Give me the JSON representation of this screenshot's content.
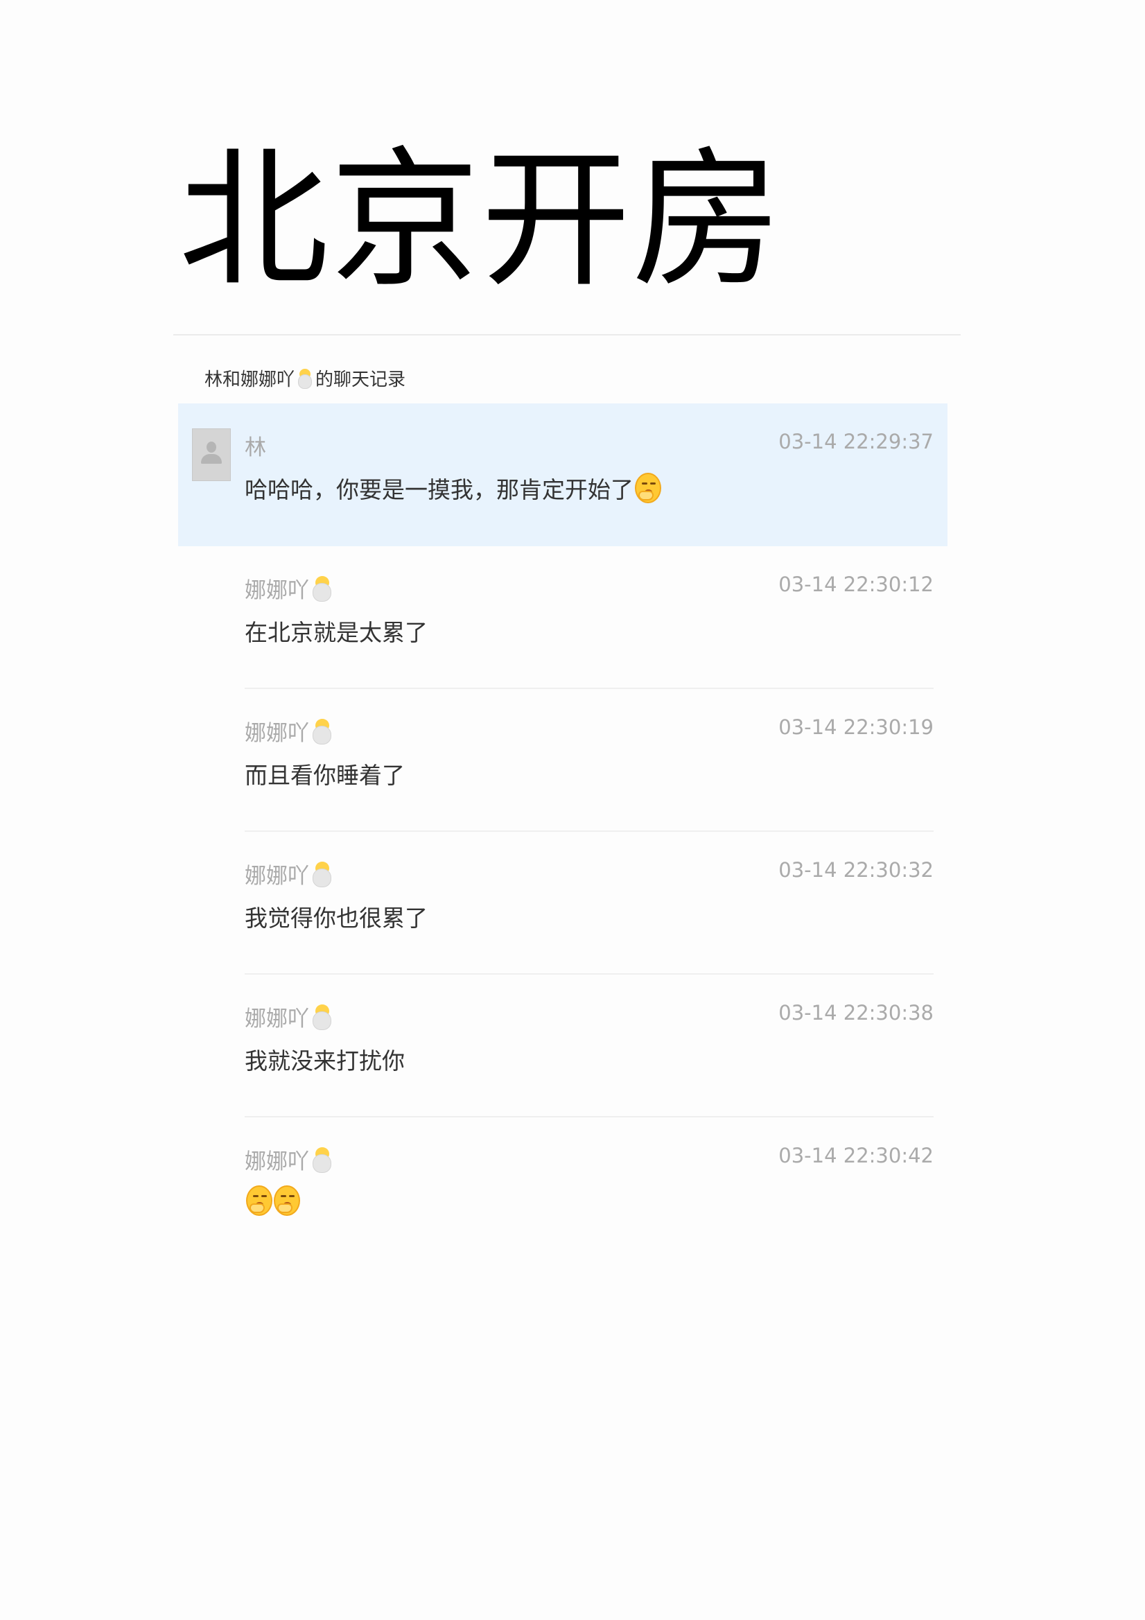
{
  "title": "北京开房",
  "history_header": {
    "prefix": "林和娜娜吖",
    "suffix": "的聊天记录"
  },
  "messages": [
    {
      "sender": "林",
      "time": "03-14 22:29:37",
      "text": "哈哈哈，你要是一摸我，那肯定开始了",
      "emoji": "hand-over-mouth-emoji"
    },
    {
      "sender": "娜娜吖",
      "time": "03-14 22:30:12",
      "text": "在北京就是太累了"
    },
    {
      "sender": "娜娜吖",
      "time": "03-14 22:30:19",
      "text": "而且看你睡着了"
    },
    {
      "sender": "娜娜吖",
      "time": "03-14 22:30:32",
      "text": "我觉得你也很累了"
    },
    {
      "sender": "娜娜吖",
      "time": "03-14 22:30:38",
      "text": "我就没来打扰你"
    },
    {
      "sender": "娜娜吖",
      "time": "03-14 22:30:42",
      "text": "",
      "emoji": "hand-over-mouth-emoji x2"
    }
  ],
  "icons": {
    "avatar": "default-avatar-icon",
    "sender_badge": "chick-in-egg-icon"
  },
  "colors": {
    "highlight_row": "#e8f3fd",
    "muted_text": "#aaaaaa"
  }
}
